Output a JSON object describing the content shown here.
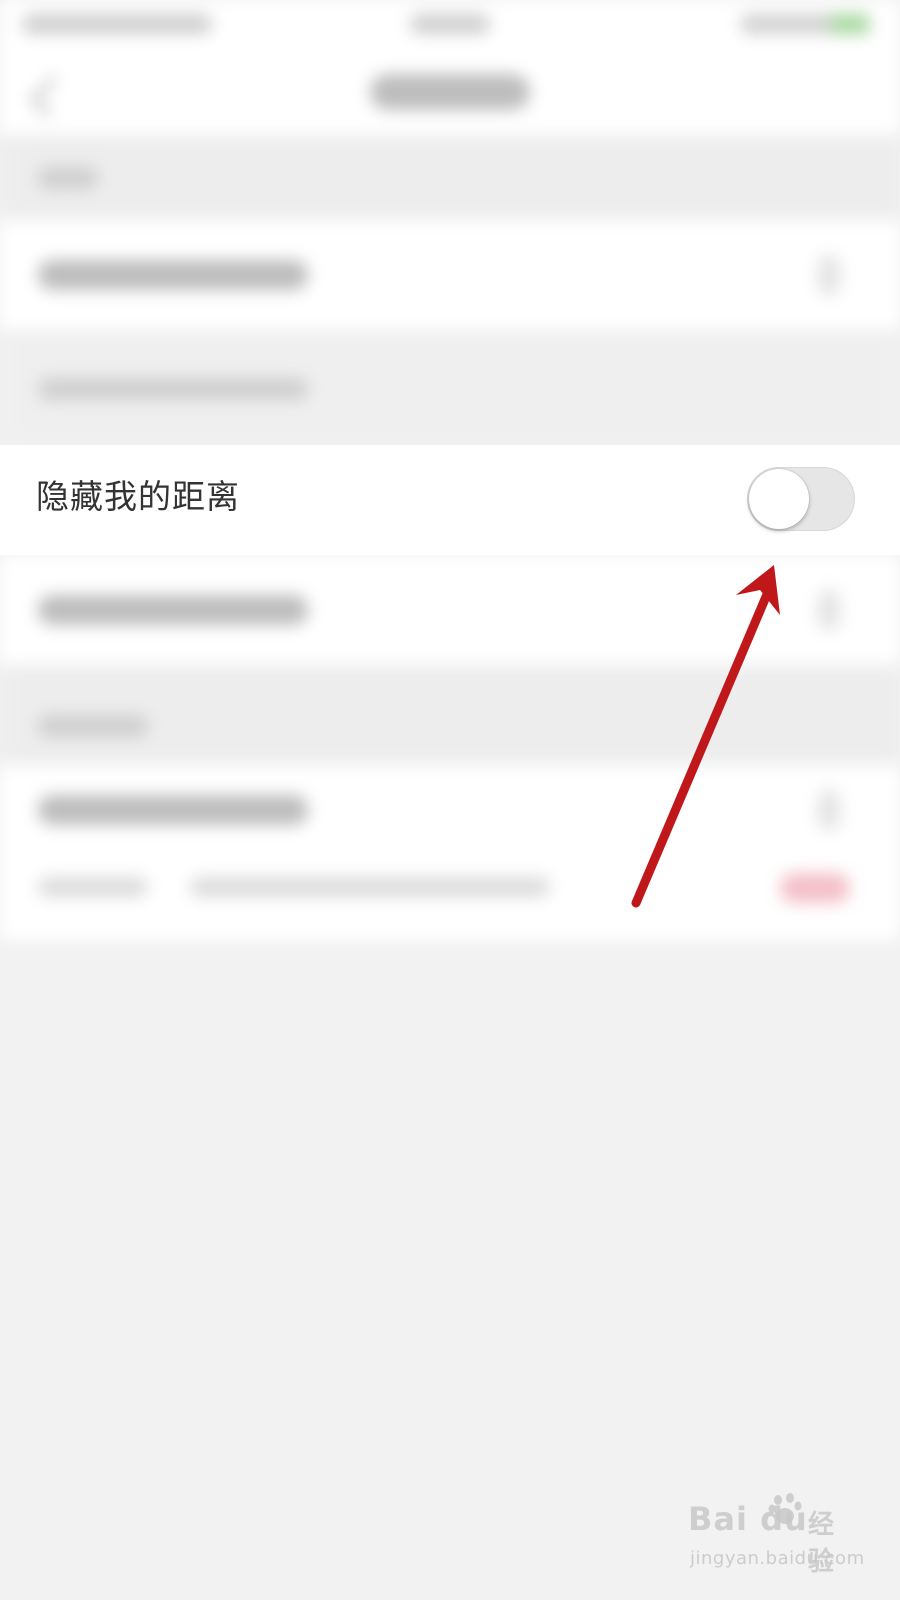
{
  "setting_row": {
    "label": "隐藏我的距离",
    "toggle_state": "off"
  },
  "colors": {
    "background": "#f2f2f2",
    "row_background": "#ffffff",
    "label_text": "#333333",
    "toggle_track_off": "#e6e6e6",
    "annotation_arrow": "#c0181a"
  },
  "watermark": {
    "logo": "Bai du",
    "brand": "经验",
    "url": "jingyan.baidu.com"
  }
}
